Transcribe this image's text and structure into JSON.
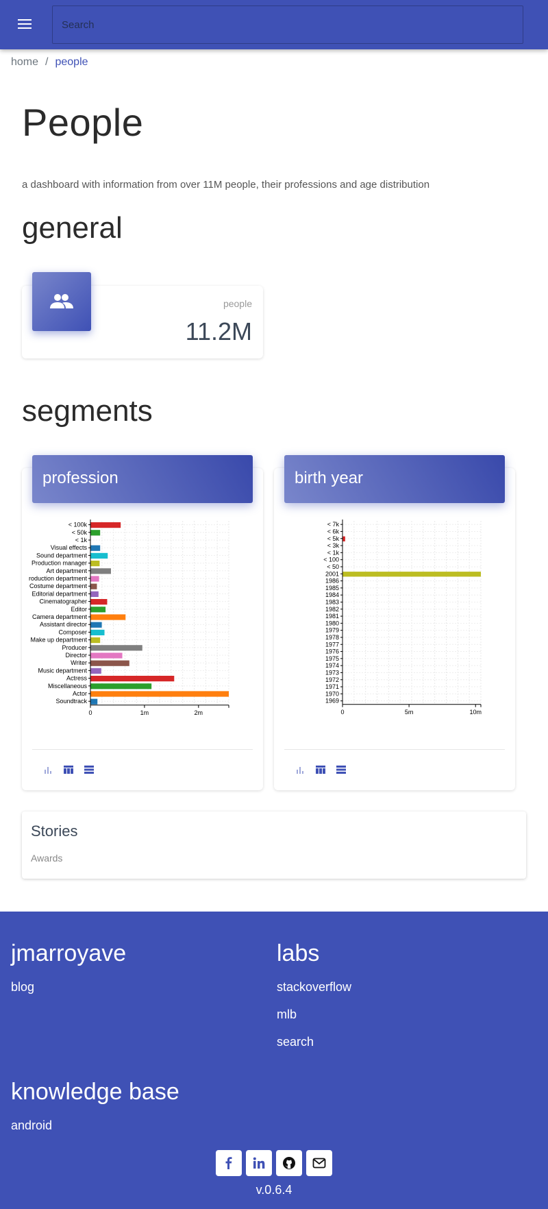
{
  "search": {
    "placeholder": "Search"
  },
  "breadcrumb": {
    "home": "home",
    "separator": "/",
    "current": "people"
  },
  "page": {
    "title": "People",
    "subtitle": "a dashboard with information from over 11M people, their professions and age distribution"
  },
  "general": {
    "heading": "general",
    "stat": {
      "label": "people",
      "value": "11.2M",
      "icon": "people-icon"
    }
  },
  "segments": {
    "heading": "segments",
    "cards": [
      {
        "title": "profession"
      },
      {
        "title": "birth year"
      }
    ]
  },
  "chart_data": [
    {
      "type": "bar",
      "orientation": "horizontal",
      "categories": [
        "< 100k",
        "< 50k",
        "< 1k",
        "Visual effects",
        "Sound department",
        "Production manager",
        "Art department",
        "Production department",
        "Costume department",
        "Editorial department",
        "Cinematographer",
        "Editor",
        "Camera department",
        "Assistant director",
        "Composer",
        "Make up department",
        "Producer",
        "Director",
        "Writer",
        "Music department",
        "Actress",
        "Miscellaneous",
        "Actor",
        "Soundtrack"
      ],
      "values": [
        560000,
        180000,
        0,
        180000,
        320000,
        170000,
        380000,
        160000,
        120000,
        150000,
        310000,
        280000,
        650000,
        210000,
        260000,
        180000,
        960000,
        590000,
        720000,
        200000,
        1550000,
        1130000,
        2560000,
        130000
      ],
      "colors": [
        "#d62728",
        "#2ca02c",
        "#bcbd22",
        "#1f77b4",
        "#17becf",
        "#bcbd22",
        "#7f7f7f",
        "#e377c2",
        "#8c564b",
        "#9467bd",
        "#d62728",
        "#2ca02c",
        "#ff7f0e",
        "#1f77b4",
        "#17becf",
        "#bcbd22",
        "#7f7f7f",
        "#e377c2",
        "#8c564b",
        "#9467bd",
        "#d62728",
        "#2ca02c",
        "#ff7f0e",
        "#1f77b4"
      ],
      "xticks": [
        "0",
        "1m",
        "2m"
      ],
      "xtick_values": [
        0,
        1000000,
        2000000
      ],
      "xlim": [
        0,
        2560000
      ],
      "grid": true
    },
    {
      "type": "bar",
      "orientation": "horizontal",
      "categories": [
        "< 7k",
        "< 6k",
        "< 5k",
        "< 3k",
        "< 1k",
        "< 100",
        "< 50",
        "2001",
        "1986",
        "1985",
        "1984",
        "1983",
        "1982",
        "1981",
        "1980",
        "1979",
        "1978",
        "1977",
        "1976",
        "1975",
        "1974",
        "1973",
        "1972",
        "1971",
        "1970",
        "1969"
      ],
      "values": [
        0,
        0,
        200000,
        0,
        0,
        0,
        0,
        10400000,
        0,
        0,
        0,
        0,
        0,
        0,
        0,
        0,
        0,
        0,
        0,
        0,
        0,
        0,
        0,
        0,
        0,
        0
      ],
      "colors": [
        "#1f77b4",
        "#ff7f0e",
        "#d62728",
        "#2ca02c",
        "#9467bd",
        "#8c564b",
        "#e377c2",
        "#bcbd22",
        "#17becf",
        "#1f77b4",
        "#ff7f0e",
        "#2ca02c",
        "#d62728",
        "#9467bd",
        "#8c564b",
        "#e377c2",
        "#7f7f7f",
        "#bcbd22",
        "#17becf",
        "#1f77b4",
        "#ff7f0e",
        "#2ca02c",
        "#d62728",
        "#9467bd",
        "#8c564b",
        "#e377c2"
      ],
      "xticks": [
        "0",
        "5m",
        "10m"
      ],
      "xtick_values": [
        0,
        5000000,
        10000000
      ],
      "xlim": [
        0,
        10400000
      ],
      "grid": true
    }
  ],
  "tools": [
    "bar-chart-icon",
    "table-icon",
    "list-icon"
  ],
  "stories": {
    "title": "Stories",
    "link": "Awards"
  },
  "footer": {
    "col1": {
      "heading": "jmarroyave",
      "links": [
        "blog"
      ]
    },
    "col2": {
      "heading": "labs",
      "links": [
        "stackoverflow",
        "mlb",
        "search"
      ]
    },
    "col3": {
      "heading": "knowledge base",
      "links": [
        "android"
      ]
    },
    "social": [
      "facebook-icon",
      "linkedin-icon",
      "github-icon",
      "email-icon"
    ],
    "version": "v.0.6.4"
  },
  "colors": {
    "primary": "#3f51b5",
    "primary_light": "#7986cb"
  }
}
